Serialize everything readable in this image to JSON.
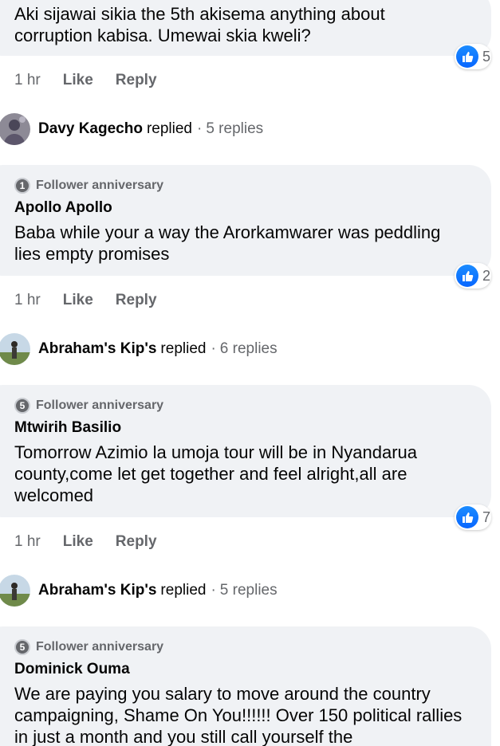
{
  "comments": [
    {
      "text": "Aki sijawai sikia the 5th akisema anything about corruption kabisa. Umewai skia kweli?",
      "likes": "5",
      "time": "1 hr",
      "like_label": "Like",
      "reply_label": "Reply",
      "replied": {
        "name": "Davy Kagecho",
        "verb": "replied",
        "sep": "·",
        "count": "5 replies"
      }
    },
    {
      "badge_number": "1",
      "badge_label": "Follower anniversary",
      "author": "Apollo Apollo",
      "text": "Baba while your a way the Arorkamwarer was peddling lies empty promises",
      "likes": "2",
      "time": "1 hr",
      "like_label": "Like",
      "reply_label": "Reply",
      "replied": {
        "name": "Abraham's Kip's",
        "verb": "replied",
        "sep": "·",
        "count": "6 replies"
      }
    },
    {
      "badge_number": "5",
      "badge_label": "Follower anniversary",
      "author": "Mtwirih Basilio",
      "text": "Tomorrow Azimio la umoja tour will be in Nyandarua county,come let get together and feel alright,all are welcomed",
      "likes": "7",
      "time": "1 hr",
      "like_label": "Like",
      "reply_label": "Reply",
      "replied": {
        "name": "Abraham's Kip's",
        "verb": "replied",
        "sep": "·",
        "count": "5 replies"
      }
    },
    {
      "badge_number": "5",
      "badge_label": "Follower anniversary",
      "author": "Dominick Ouma",
      "text": "We are paying you salary to move around the country campaigning, Shame On You!!!!!! Over 150 political rallies in just a month and you still call yourself the"
    }
  ],
  "colors": {
    "like_blue": "#0866ff",
    "bubble": "#f0f2f5",
    "meta": "#65676b"
  },
  "icons": {
    "like": "thumbs-up-icon",
    "badge": "follower-anniversary-badge-icon"
  }
}
